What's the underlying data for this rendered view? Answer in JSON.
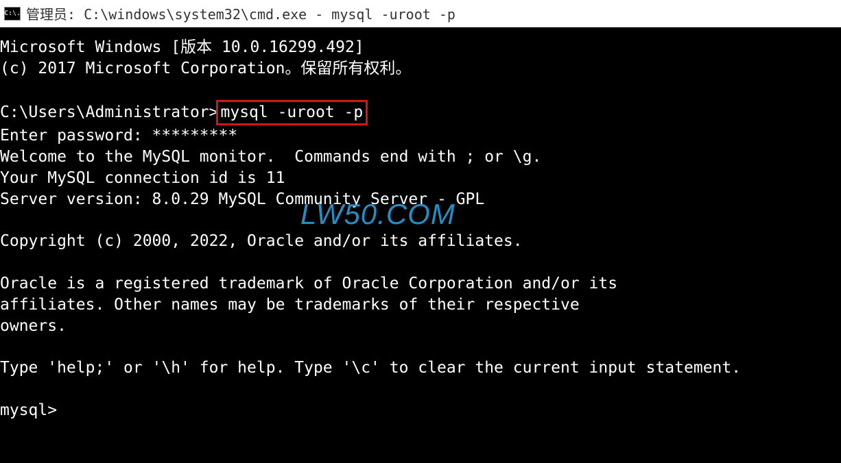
{
  "title_bar": {
    "icon_text": "C:\\.",
    "title": "管理员: C:\\windows\\system32\\cmd.exe - mysql  -uroot -p"
  },
  "console": {
    "line1": "Microsoft Windows [版本 10.0.16299.492]",
    "line2": "(c) 2017 Microsoft Corporation。保留所有权利。",
    "line3": "",
    "prompt_path": "C:\\Users\\Administrator>",
    "highlighted_cmd": "mysql -uroot -p",
    "line5": "Enter password: *********",
    "line6": "Welcome to the MySQL monitor.  Commands end with ; or \\g.",
    "line7": "Your MySQL connection id is 11",
    "line8": "Server version: 8.0.29 MySQL Community Server - GPL",
    "line9": "",
    "line10": "Copyright (c) 2000, 2022, Oracle and/or its affiliates.",
    "line11": "",
    "line12": "Oracle is a registered trademark of Oracle Corporation and/or its",
    "line13": "affiliates. Other names may be trademarks of their respective",
    "line14": "owners.",
    "line15": "",
    "line16": "Type 'help;' or '\\h' for help. Type '\\c' to clear the current input statement.",
    "line17": "",
    "line18": "mysql>"
  },
  "watermark": "LW50.COM"
}
